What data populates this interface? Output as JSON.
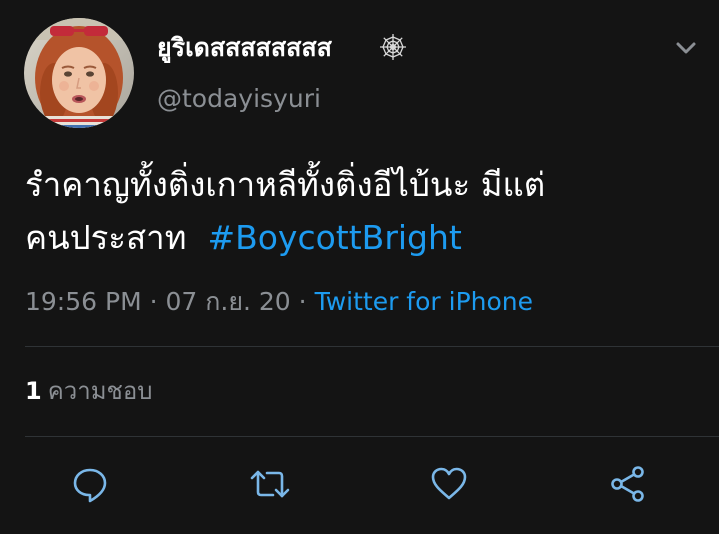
{
  "user": {
    "display_name": "ยูริเดสสสสสสสส",
    "name_icon": "spider-web-icon",
    "handle": "@todayisyuri",
    "avatar": "profile-photo-red-hair"
  },
  "tweet": {
    "text_line1": "รำคาญทั้งติ่งเกาหลีทั้งติ่งอีไบ้นะ มีแต่",
    "text_line2": "คนประสาท",
    "hashtag": "#BoycottBright",
    "time": "19:56 PM",
    "separator": "·",
    "date": "07 ก.ย. 20",
    "source": "Twitter for iPhone"
  },
  "stats": {
    "likes_count": "1",
    "likes_label": "ความชอบ"
  },
  "actions": [
    {
      "name": "reply",
      "icon": "reply-icon"
    },
    {
      "name": "retweet",
      "icon": "retweet-icon"
    },
    {
      "name": "like",
      "icon": "heart-icon"
    },
    {
      "name": "share",
      "icon": "share-icon"
    }
  ],
  "colors": {
    "background": "#141414",
    "text": "#ffffff",
    "secondary": "#8b8f94",
    "accent": "#1d9bf0",
    "icon": "#7ab7e8",
    "divider": "#2f3336"
  }
}
